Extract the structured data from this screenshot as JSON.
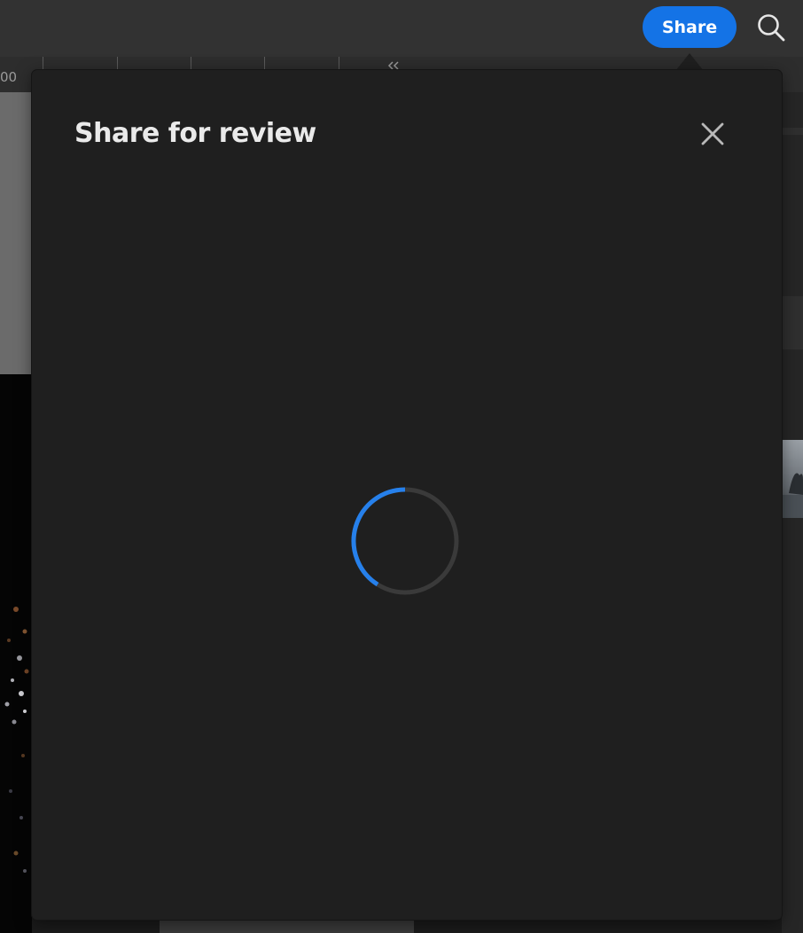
{
  "topbar": {
    "share_label": "Share",
    "icons": {
      "search": "search-icon"
    }
  },
  "ruler": {
    "label": "00",
    "collapse_icon": "double-chevron-left-icon"
  },
  "dialog": {
    "title": "Share for review",
    "close_icon": "close-icon",
    "loading_icon": "loading-spinner-icon"
  },
  "colors": {
    "accent": "#1473e6",
    "dialog_background": "#1f1f1f",
    "topbar_background": "#323232",
    "title_text": "#eaeaea",
    "spinner_track": "#3a3a3a",
    "spinner_active": "#2680eb"
  }
}
